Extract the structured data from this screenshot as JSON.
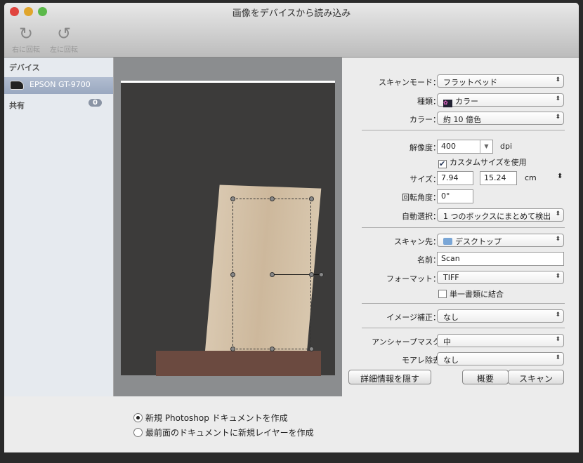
{
  "window": {
    "title": "画像をデバイスから読み込み"
  },
  "toolbar": {
    "rotate_right": "右に回転",
    "rotate_left": "左に回転"
  },
  "sidebar": {
    "devices_header": "デバイス",
    "device": "EPSON GT-9700",
    "shared_header": "共有",
    "shared_count": "0"
  },
  "settings": {
    "scan_mode": {
      "label": "スキャンモード：",
      "value": "フラットベッド"
    },
    "kind": {
      "label": "種類：",
      "value": "カラー"
    },
    "color": {
      "label": "カラー：",
      "value": "約 10 億色"
    },
    "resolution": {
      "label": "解像度：",
      "value": "400",
      "unit": "dpi"
    },
    "custom_size": {
      "label": "カスタムサイズを使用",
      "checked": true
    },
    "size": {
      "label": "サイズ：",
      "width": "7.94",
      "height": "15.24",
      "unit": "cm"
    },
    "rotation": {
      "label": "回転角度：",
      "value": "0°"
    },
    "auto_select": {
      "label": "自動選択：",
      "value": "1 つのボックスにまとめて検出"
    },
    "scan_to": {
      "label": "スキャン先：",
      "value": "デスクトップ"
    },
    "name": {
      "label": "名前：",
      "value": "Scan"
    },
    "format": {
      "label": "フォーマット：",
      "value": "TIFF"
    },
    "combine": {
      "label": "単一書類に結合",
      "checked": false
    },
    "image_correction": {
      "label": "イメージ補正：",
      "value": "なし"
    },
    "unsharp_mask": {
      "label": "アンシャープマスク",
      "value": "中"
    },
    "moire": {
      "label": "モアレ除去",
      "value": "なし"
    }
  },
  "buttons": {
    "hide_details": "詳細情報を隠す",
    "overview": "概要",
    "scan": "スキャン"
  },
  "options": {
    "new_doc": "新規 Photoshop ドキュメントを作成",
    "new_layer": "最前面のドキュメントに新規レイヤーを作成",
    "selected": "new_doc"
  }
}
